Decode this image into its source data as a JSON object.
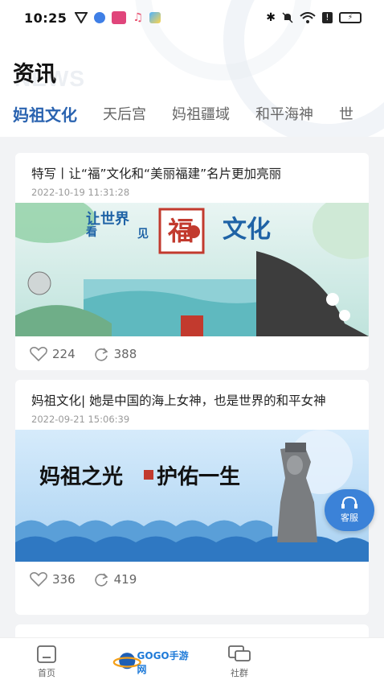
{
  "status": {
    "time": "10:25",
    "battery_label": "⚡"
  },
  "page": {
    "title": "资讯",
    "title_ghost": "NEWS"
  },
  "tabs": [
    {
      "label": "妈祖文化",
      "active": true
    },
    {
      "label": "天后宫"
    },
    {
      "label": "妈祖疆域"
    },
    {
      "label": "和平海神"
    },
    {
      "label": "世"
    }
  ],
  "articles": [
    {
      "title": "特写丨让“福”文化和“美丽福建”名片更加亮丽",
      "date": "2022-10-19 11:31:28",
      "image_text_a": "让世界",
      "image_text_b": "看",
      "image_text_c": "见",
      "image_text_fu": "福",
      "image_text_d": "文化",
      "likes": "224",
      "shares": "388"
    },
    {
      "title": "妈祖文化| 她是中国的海上女神，也是世界的和平女神",
      "date": "2022-09-21 15:06:39",
      "image_text_a": "妈祖之光",
      "image_text_b": "护佑一生",
      "likes": "336",
      "shares": "419"
    }
  ],
  "service": {
    "label": "客服"
  },
  "bottom_nav": {
    "home": "首页",
    "community": "社群"
  },
  "watermark": {
    "text": "GOGO手游网"
  },
  "colors": {
    "accent": "#2a63b0",
    "service": "#3b82d8",
    "background": "#f2f3f5"
  }
}
